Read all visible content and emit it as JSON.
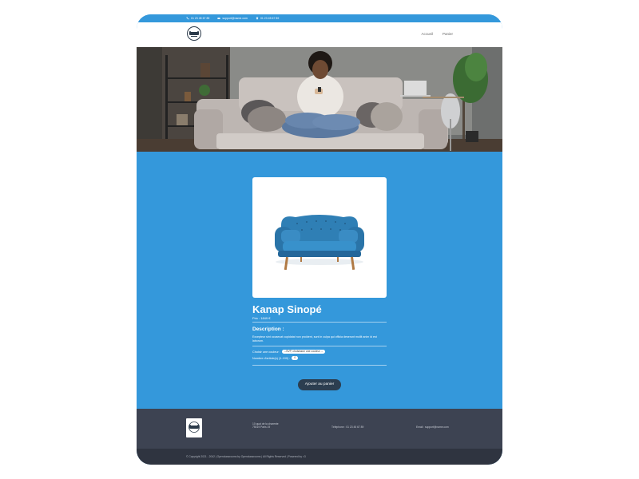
{
  "topbar": {
    "phone": "01 23 45 67 89",
    "email": "support@name.com",
    "location": "01 23 45 67 89"
  },
  "header": {
    "nav": [
      {
        "label": "Accueil"
      },
      {
        "label": "Panier"
      }
    ]
  },
  "product": {
    "title": "Kanap Sinopé",
    "price": "Prix : 1849 €",
    "description_title": "Description :",
    "description": "Excepteur sint occaecat cupidatat non proident, sunt in culpa qui officia deserunt mollit anim id est laborum.",
    "color_label": "Choisir une couleur :",
    "color_value": "--SVP, choisissez une couleur --",
    "quantity_label": "Nombre d'article(s) (1-100) :",
    "quantity_value": "0",
    "add_button": "Ajouter au panier"
  },
  "footer": {
    "address_line1": "10 quai de la charente",
    "address_line2": "75019 Paris 19",
    "phone": "Téléphone : 01 23 45 67 89",
    "email": "Email : support@name.com",
    "copyright": "© Copyright 2021 - 2042 | Openclassrooms by Openclassrooms | All Rights Reserved | Powered by <3"
  },
  "colors": {
    "accent": "#3498db",
    "button": "#2c3e50",
    "footer": "#3d4352",
    "sofa": "#2f7fb5"
  },
  "icons": [
    "phone-icon",
    "mail-icon",
    "location-icon",
    "logo-icon"
  ]
}
